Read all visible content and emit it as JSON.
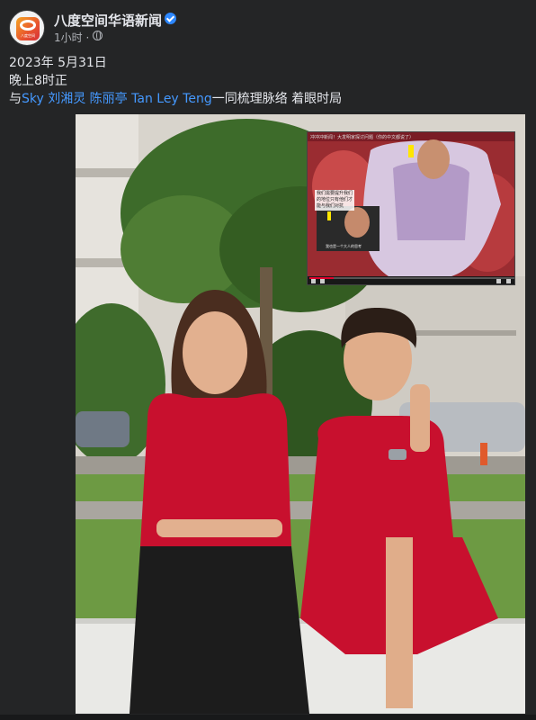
{
  "post": {
    "page_name": "八度空间华语新闻",
    "avatar_text": "八度空间",
    "time": "1小时 ·",
    "verified": true,
    "lines": {
      "date": "2023年 5月31日",
      "time": "晚上8时正",
      "prefix": "与",
      "tags": "Sky 刘湘灵 陈丽亭 Tan Ley Teng",
      "suffix": "一同梳理脉络 着眼时局"
    }
  },
  "video_inset": {
    "title": "冲冲冲新闻！大发明家探讨问题（你的中文都说了）",
    "subtitle": "我们需要提升我们的地位只有他们才能与我们对抗",
    "caption": "我也是一个大人的思考",
    "progress": 0.12
  },
  "colors": {
    "background": "#242526",
    "text": "#e4e6eb",
    "muted": "#b0b3b8",
    "link": "#4599ff",
    "verified": "#2d88ff",
    "dress": "#c8102e"
  },
  "icons": [
    "verified-badge-icon",
    "globe-icon",
    "play-icon",
    "volume-icon",
    "settings-icon",
    "fullscreen-icon"
  ]
}
